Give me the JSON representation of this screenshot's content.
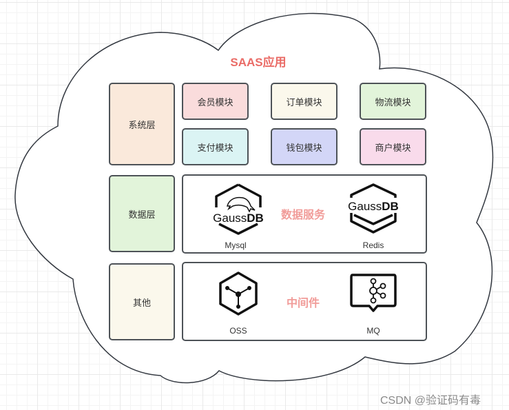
{
  "diagram": {
    "title": "SAAS应用",
    "container_shape": "cloud",
    "layers": [
      {
        "label": "系统层",
        "color": "#fae9db",
        "modules": [
          {
            "label": "会员模块",
            "color": "#fadcdc"
          },
          {
            "label": "订单模块",
            "color": "#fbf8ec"
          },
          {
            "label": "物流模块",
            "color": "#e2f4da"
          },
          {
            "label": "支付模块",
            "color": "#dbf4f4"
          },
          {
            "label": "钱包模块",
            "color": "#d3d6f7"
          },
          {
            "label": "商户模块",
            "color": "#f9dbeb"
          }
        ]
      },
      {
        "label": "数据层",
        "color": "#e2f4da",
        "group_label": "数据服务",
        "services": [
          {
            "label": "Mysql",
            "icon": "gaussdb-mysql-icon",
            "logo_text_light": "Gauss",
            "logo_text_bold": "DB"
          },
          {
            "label": "Redis",
            "icon": "gaussdb-redis-icon",
            "logo_text_light": "Gauss",
            "logo_text_bold": "DB"
          }
        ]
      },
      {
        "label": "其他",
        "color": "#fbf8ec",
        "group_label": "中间件",
        "services": [
          {
            "label": "OSS",
            "icon": "object-storage-icon"
          },
          {
            "label": "MQ",
            "icon": "message-queue-icon"
          }
        ]
      }
    ],
    "colors": {
      "title": "#ea6b66",
      "group_label": "#f19c99",
      "stroke": "#4d5257"
    }
  },
  "watermark": "CSDN @验证码有毒"
}
